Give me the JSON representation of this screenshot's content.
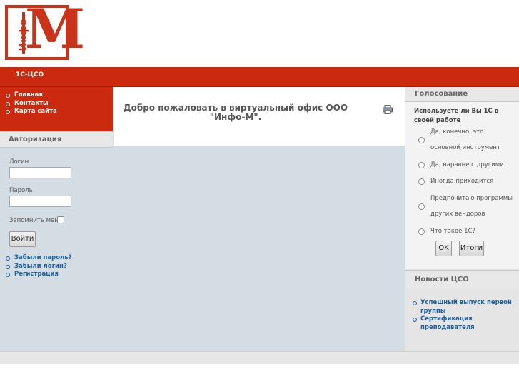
{
  "logo": {
    "text_vertical": "Инфо",
    "letter": "М"
  },
  "topnav": {
    "tab": "1С-ЦСО"
  },
  "mainmenu": {
    "items": [
      "Главная",
      "Контакты",
      "Карта сайта"
    ]
  },
  "auth": {
    "title": "Авторизация",
    "login_label": "Логин",
    "login_value": "",
    "password_label": "Пароль",
    "password_value": "",
    "remember_label": "Запомнить меня",
    "submit": "Войти",
    "links": [
      "Забыли пароль?",
      "Забыли логин?",
      "Регистрация"
    ]
  },
  "content": {
    "welcome": "Добро пожаловать в виртуальный офис ООО \"Инфо-М\"."
  },
  "poll": {
    "title": "Голосование",
    "question": "Используете ли Вы 1С в своей работе",
    "options": [
      "Да, конечно, это основной инструмент",
      "Да, наравне с другими",
      "Иногда приходится",
      "Предпочитаю программы других вендоров",
      "Что такое 1С?"
    ],
    "ok_button": "OK",
    "results_button": "Итоги"
  },
  "news": {
    "title": "Новости ЦСО",
    "items": [
      "Успешный выпуск первой группы",
      "Сертификация преподавателя"
    ]
  },
  "colors": {
    "brand_red": "#cc2a0e",
    "panel_blue": "#d3dde3",
    "link": "#1a5fa0"
  }
}
